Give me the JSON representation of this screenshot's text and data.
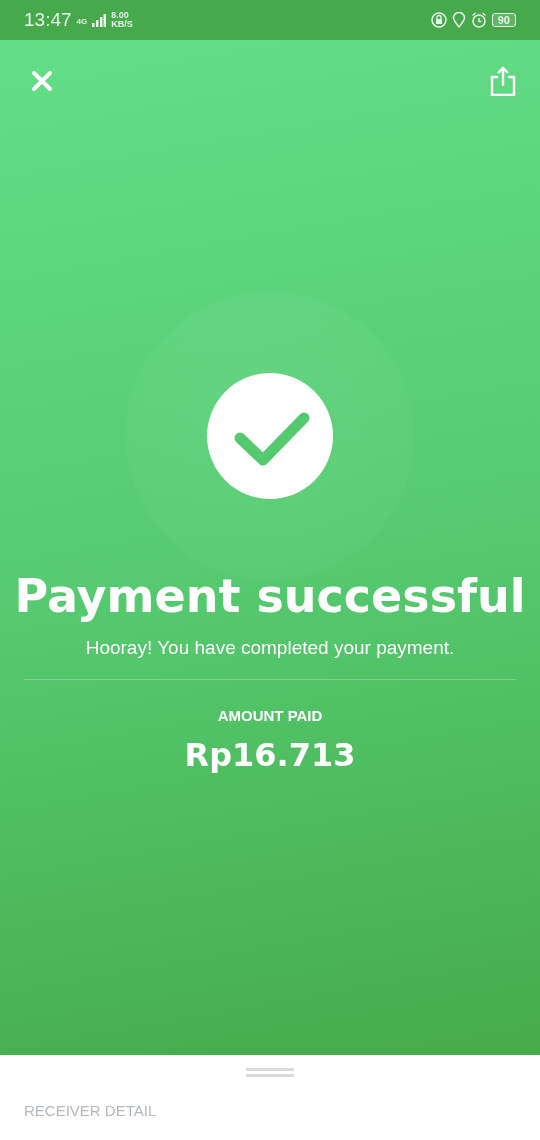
{
  "status_bar": {
    "time": "13:47",
    "network": "4G",
    "speed": "8.00",
    "speed_unit": "KB/S",
    "battery": "90"
  },
  "result": {
    "title": "Payment successful",
    "message": "Hooray! You have completed your payment.",
    "amount_label": "AMOUNT PAID",
    "amount": "Rp16.713"
  },
  "sheet": {
    "section_title": "RECEIVER DETAIL"
  }
}
